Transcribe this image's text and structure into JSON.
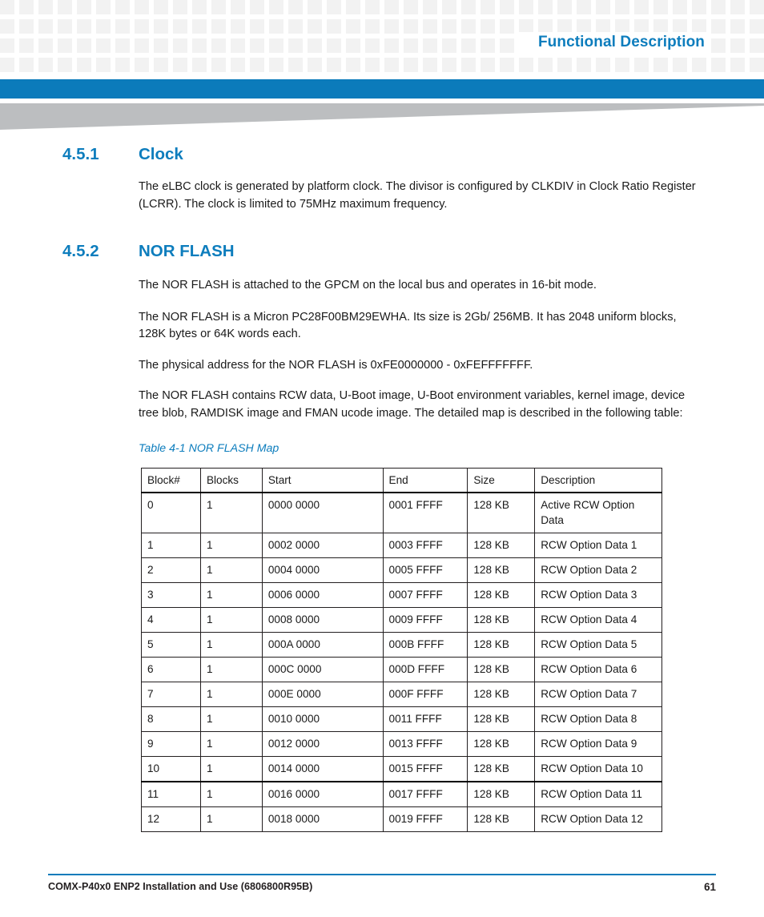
{
  "header": {
    "title": "Functional Description"
  },
  "sections": [
    {
      "number": "4.5.1",
      "title": "Clock",
      "paragraphs": [
        "The eLBC clock is generated by platform clock. The divisor is configured by CLKDIV in Clock Ratio Register (LCRR). The clock is limited to 75MHz maximum frequency."
      ]
    },
    {
      "number": "4.5.2",
      "title": "NOR FLASH",
      "paragraphs": [
        "The NOR FLASH is attached to the GPCM on the local bus and operates in 16-bit mode.",
        "The NOR FLASH is a Micron PC28F00BM29EWHA. Its size is 2Gb/ 256MB. It has 2048 uniform blocks, 128K bytes or 64K words each.",
        "The physical address for the NOR FLASH is 0xFE0000000 - 0xFEFFFFFFF.",
        "The NOR FLASH contains RCW data, U-Boot image, U-Boot environment variables, kernel image, device tree blob, RAMDISK image and FMAN ucode image. The detailed map is described in the following table:"
      ]
    }
  ],
  "table": {
    "caption": "Table 4-1 NOR FLASH Map",
    "columns": [
      "Block#",
      "Blocks",
      "Start",
      "End",
      "Size",
      "Description"
    ],
    "rows": [
      [
        "0",
        "1",
        "0000 0000",
        "0001 FFFF",
        "128 KB",
        "Active RCW Option Data"
      ],
      [
        "1",
        "1",
        "0002 0000",
        "0003 FFFF",
        "128 KB",
        "RCW Option Data 1"
      ],
      [
        "2",
        "1",
        "0004 0000",
        "0005 FFFF",
        "128 KB",
        "RCW Option Data 2"
      ],
      [
        "3",
        "1",
        "0006 0000",
        "0007 FFFF",
        "128 KB",
        "RCW Option Data 3"
      ],
      [
        "4",
        "1",
        "0008 0000",
        "0009 FFFF",
        "128 KB",
        "RCW Option Data 4"
      ],
      [
        "5",
        "1",
        "000A 0000",
        "000B FFFF",
        "128 KB",
        "RCW Option Data 5"
      ],
      [
        "6",
        "1",
        "000C 0000",
        "000D FFFF",
        "128 KB",
        "RCW Option Data 6"
      ],
      [
        "7",
        "1",
        "000E 0000",
        "000F FFFF",
        "128 KB",
        "RCW Option Data 7"
      ],
      [
        "8",
        "1",
        "0010 0000",
        "0011 FFFF",
        "128 KB",
        "RCW Option Data 8"
      ],
      [
        "9",
        "1",
        "0012 0000",
        "0013 FFFF",
        "128 KB",
        "RCW Option Data 9"
      ],
      [
        "10",
        "1",
        "0014 0000",
        "0015 FFFF",
        "128 KB",
        "RCW Option Data 10"
      ],
      [
        "11",
        "1",
        "0016 0000",
        "0017 FFFF",
        "128 KB",
        "RCW Option Data 11"
      ],
      [
        "12",
        "1",
        "0018 0000",
        "0019 FFFF",
        "128 KB",
        "RCW Option Data 12"
      ]
    ]
  },
  "footer": {
    "document": "COMX-P40x0 ENP2 Installation and Use (6806800R95B)",
    "page": "61"
  },
  "colors": {
    "accent_blue": "#0b7bbb",
    "heading_blue": "#0d7dbd",
    "wedge_gray": "#bcbec0",
    "header_square": "#f2f2f2"
  }
}
